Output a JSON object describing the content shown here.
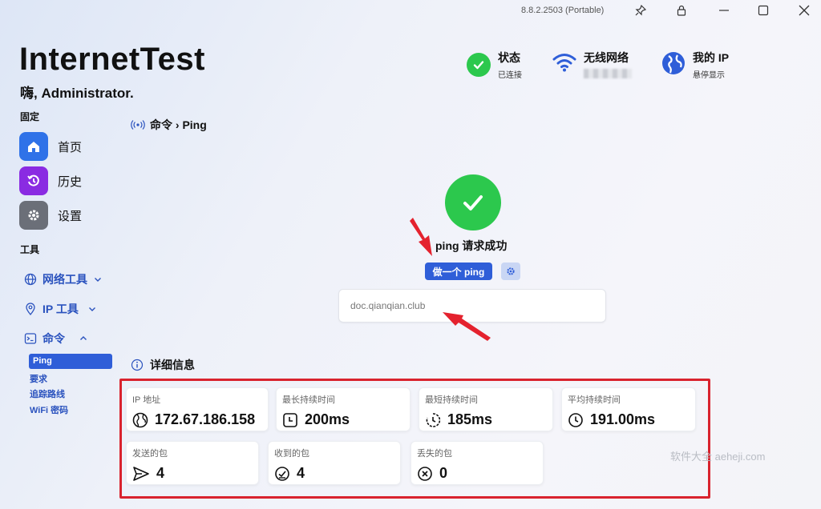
{
  "titlebar": {
    "version": "8.8.2.2503 (Portable)",
    "buttons": [
      "pin-icon",
      "lock-icon",
      "minimize-icon",
      "maximize-icon",
      "close-icon"
    ]
  },
  "header": {
    "app_title": "InternetTest",
    "greeting": "嗨, Administrator."
  },
  "status_bar": {
    "status": {
      "label": "状态",
      "value": "已连接",
      "icon": "check-circle-icon",
      "color": "#2cc84d"
    },
    "wifi": {
      "label": "无线网络",
      "value": "",
      "icon": "wifi-icon",
      "color": "#2f5ed8"
    },
    "my_ip": {
      "label": "我的 IP",
      "value": "悬停显示",
      "icon": "globe-icon",
      "color": "#2f5ed8"
    }
  },
  "sidebar": {
    "pinned_label": "固定",
    "pinned": [
      {
        "label": "首页",
        "icon": "home-icon",
        "color": "#2f72e8"
      },
      {
        "label": "历史",
        "icon": "history-icon",
        "color": "#8a2be2"
      },
      {
        "label": "设置",
        "icon": "gear-icon",
        "color": "#6b6f78"
      }
    ],
    "tools_label": "工具",
    "tools": [
      {
        "label": "网络工具",
        "icon": "globe-icon",
        "expanded": false
      },
      {
        "label": "IP 工具",
        "icon": "location-icon",
        "expanded": false
      },
      {
        "label": "命令",
        "icon": "terminal-icon",
        "expanded": true
      }
    ],
    "command_items": [
      "Ping",
      "要求",
      "追踪路线",
      "WiFi 密码"
    ],
    "active_command": "Ping"
  },
  "main": {
    "breadcrumb": "命令 › Ping",
    "result_text": "ping 请求成功",
    "ping_button": "做一个 ping",
    "host_value": "doc.qianqian.club",
    "details_title": "详细信息",
    "stats": [
      {
        "label": "IP 地址",
        "value": "172.67.186.158",
        "icon": "globe-icon"
      },
      {
        "label": "最长持续时间",
        "value": "200ms",
        "icon": "clock-square-icon"
      },
      {
        "label": "最短持续时间",
        "value": "185ms",
        "icon": "timer-icon"
      },
      {
        "label": "平均持续时间",
        "value": "191.00ms",
        "icon": "clock-icon"
      },
      {
        "label": "发送的包",
        "value": "4",
        "icon": "send-icon"
      },
      {
        "label": "收到的包",
        "value": "4",
        "icon": "received-icon"
      },
      {
        "label": "丢失的包",
        "value": "0",
        "icon": "lost-icon"
      }
    ]
  },
  "watermark": "软件大全 aeheji.com",
  "colors": {
    "accent": "#2f5ed8",
    "highlight": "#d9232e",
    "success": "#2cc84d"
  }
}
